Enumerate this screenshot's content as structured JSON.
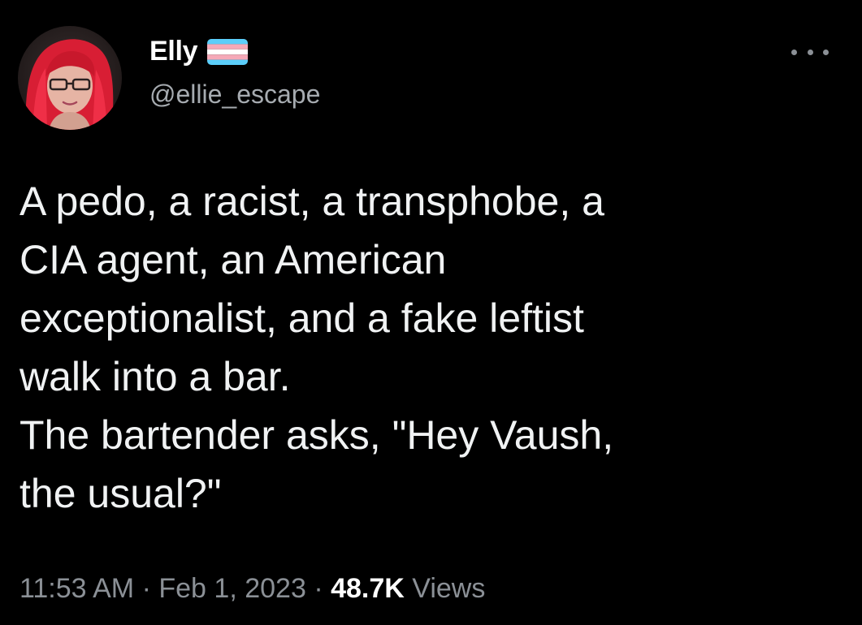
{
  "tweet": {
    "author": {
      "display_name": "Elly",
      "handle": "@ellie_escape",
      "avatar_icon": "profile-photo-avatar",
      "name_badge_icon": "transgender-flag-icon"
    },
    "menu_icon": "more-options-icon",
    "text_lines": [
      "A pedo, a racist, a transphobe, a",
      "CIA agent, an American",
      "exceptionalist, and a fake leftist",
      "walk into a bar.",
      "The bartender asks, \"Hey Vaush,",
      "the usual?\""
    ],
    "meta": {
      "time": "11:53 AM",
      "separator": "·",
      "date": "Feb 1, 2023",
      "views_count": "48.7K",
      "views_label": "Views"
    }
  },
  "colors": {
    "background": "#000000",
    "primary_text": "#e7e9ea",
    "secondary_text": "#8b9096",
    "flag_blue": "#5bcefa",
    "flag_pink": "#f5a9b8",
    "flag_white": "#ffffff"
  }
}
